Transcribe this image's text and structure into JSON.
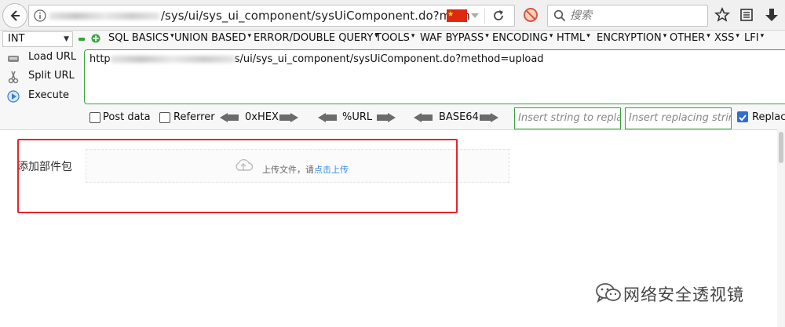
{
  "browser": {
    "url_partial": "/sys/ui/sys_ui_component/sysUiComponent.do?metho",
    "search_placeholder": "搜索",
    "icons": [
      "back-icon",
      "info-icon",
      "flag-cn-icon",
      "dropdown-icon",
      "reload-icon",
      "blocked-icon",
      "search-icon",
      "star-icon",
      "reader-icon",
      "download-icon"
    ]
  },
  "hackbar": {
    "int_select": "INT",
    "menu": [
      "SQL BASICS",
      "UNION BASED",
      "ERROR/DOUBLE QUERY",
      "TOOLS",
      "WAF BYPASS",
      "ENCODING",
      "HTML",
      "ENCRYPTION",
      "OTHER",
      "XSS",
      "LFI"
    ],
    "buttons": {
      "load_url": "Load URL",
      "split_url": "Split URL",
      "execute": "Execute"
    },
    "url_value_prefix": "http",
    "url_value_suffix": "s/ui/sys_ui_component/sysUiComponent.do?method=upload",
    "options": {
      "post_data": "Post data",
      "referrer": "Referrer",
      "hex": "0xHEX",
      "url": "%URL",
      "base64": "BASE64",
      "replace_placeholder": "Insert string to replace",
      "replacing_placeholder": "Insert replacing string",
      "replace_checked_label": "Replace"
    },
    "accent_color": "#3ba13b"
  },
  "page": {
    "form_label": "添加部件包",
    "upload_text": "上传文件，请",
    "upload_link": "点击上传",
    "highlight_color": "#e3262b",
    "link_color": "#3a8ee6"
  },
  "watermark": {
    "text": "网络安全透视镜"
  }
}
